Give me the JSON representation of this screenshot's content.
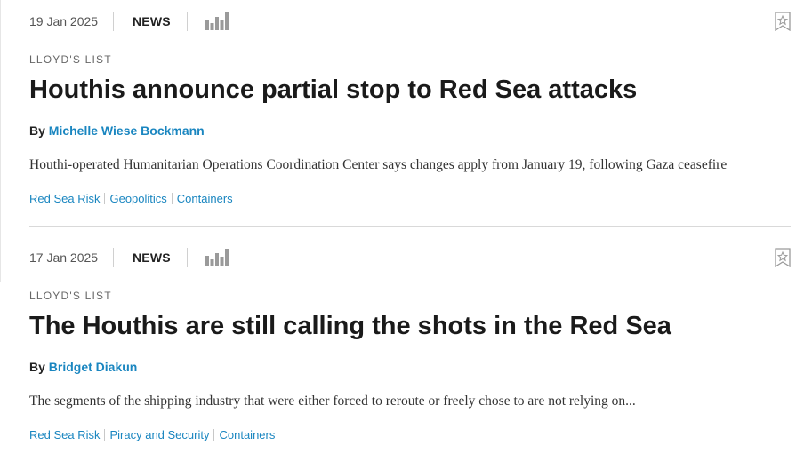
{
  "colors": {
    "link": "#1a86c0",
    "headline": "#1a1a1a",
    "muted": "#666666",
    "divider": "#d9d9d9"
  },
  "icons": {
    "chart": "bar-chart-icon",
    "bookmark": "star-bookmark-icon"
  },
  "articles": [
    {
      "date": "19 Jan 2025",
      "type": "NEWS",
      "source": "LLOYD'S LIST",
      "headline": "Houthis announce partial stop to Red Sea attacks",
      "by_label": "By",
      "author": "Michelle Wiese Bockmann",
      "summary": "Houthi-operated Humanitarian Operations Coordination Center says changes apply from January 19, following Gaza ceasefire",
      "tags": [
        "Red Sea Risk",
        "Geopolitics",
        "Containers"
      ]
    },
    {
      "date": "17 Jan 2025",
      "type": "NEWS",
      "source": "LLOYD'S LIST",
      "headline": "The Houthis are still calling the shots in the Red Sea",
      "by_label": "By",
      "author": "Bridget Diakun",
      "summary": "The segments of the shipping industry that were either forced to reroute or freely chose to are not relying on...",
      "tags": [
        "Red Sea Risk",
        "Piracy and Security",
        "Containers"
      ]
    }
  ]
}
